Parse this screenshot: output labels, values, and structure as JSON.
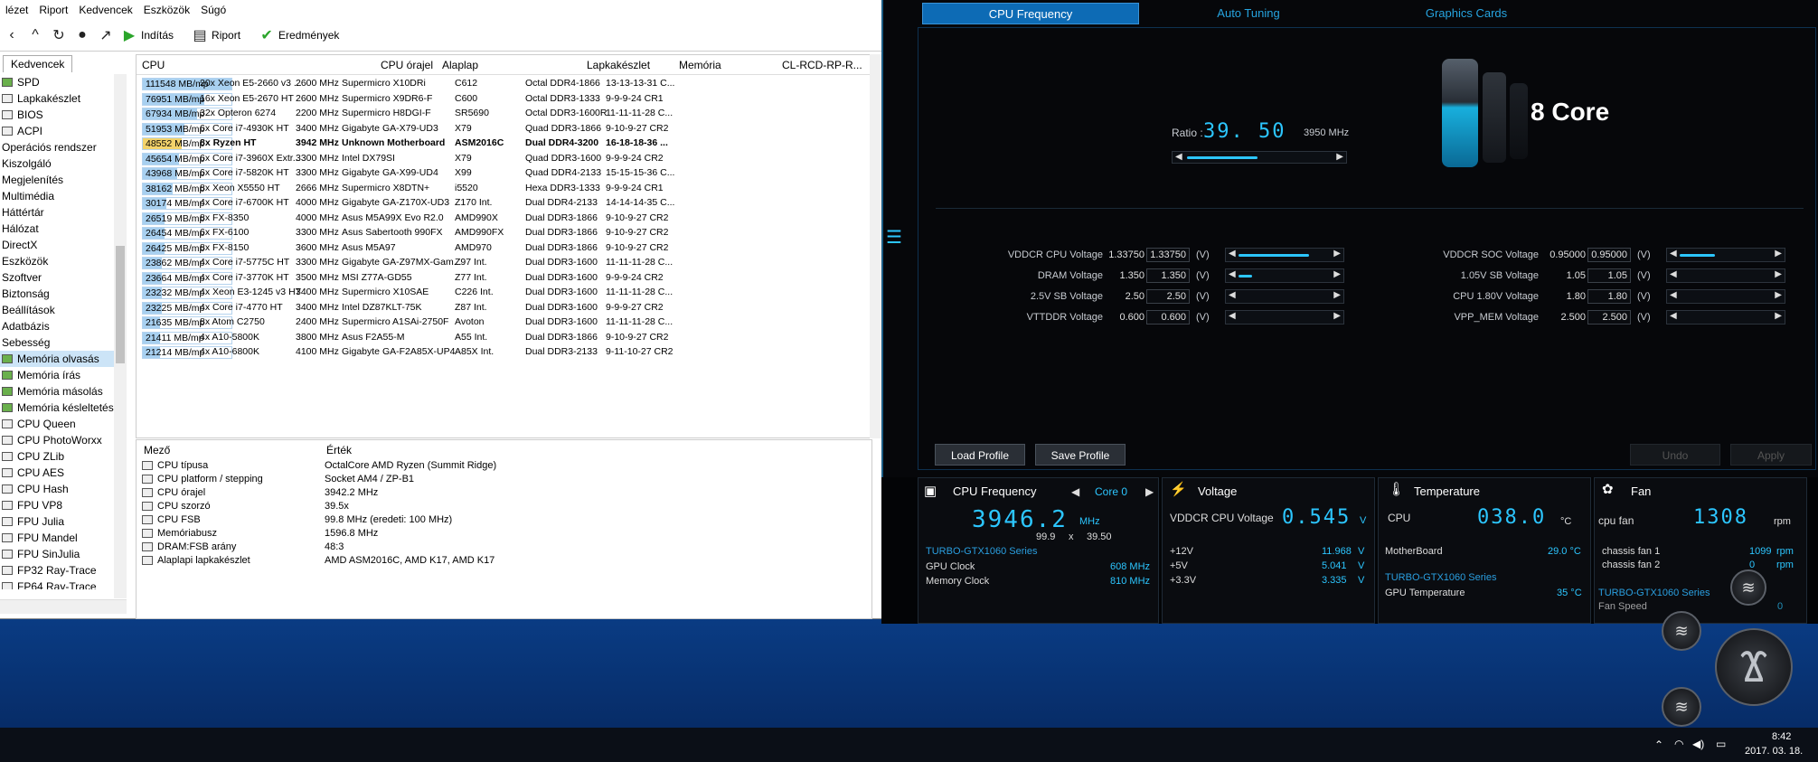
{
  "aida": {
    "menu": [
      "lézet",
      "Riport",
      "Kedvencek",
      "Eszközök",
      "Súgó"
    ],
    "toolbar": {
      "start": "Indítás",
      "report": "Riport",
      "results": "Eredmények"
    },
    "left_tab": "Kedvencek",
    "tree": [
      {
        "label": "SPD",
        "icon": "ram-icon"
      },
      {
        "label": "Lapkakészlet",
        "icon": "chip-icon"
      },
      {
        "label": "BIOS",
        "icon": "chip-icon"
      },
      {
        "label": "ACPI",
        "icon": "chip-icon"
      },
      {
        "label": "Operációs rendszer",
        "icon": ""
      },
      {
        "label": "Kiszolgáló",
        "icon": ""
      },
      {
        "label": "Megjelenítés",
        "icon": ""
      },
      {
        "label": "Multimédia",
        "icon": ""
      },
      {
        "label": "Háttértár",
        "icon": ""
      },
      {
        "label": "Hálózat",
        "icon": ""
      },
      {
        "label": "DirectX",
        "icon": ""
      },
      {
        "label": "Eszközök",
        "icon": ""
      },
      {
        "label": "Szoftver",
        "icon": ""
      },
      {
        "label": "Biztonság",
        "icon": ""
      },
      {
        "label": "Beállítások",
        "icon": ""
      },
      {
        "label": "Adatbázis",
        "icon": ""
      },
      {
        "label": "Sebesség",
        "icon": ""
      },
      {
        "label": "Memória olvasás",
        "icon": "ram-icon",
        "selected": true
      },
      {
        "label": "Memória írás",
        "icon": "ram-icon"
      },
      {
        "label": "Memória másolás",
        "icon": "ram-icon"
      },
      {
        "label": "Memória késleltetés",
        "icon": "ram-icon"
      },
      {
        "label": "CPU Queen",
        "icon": "cpu-icon"
      },
      {
        "label": "CPU PhotoWorxx",
        "icon": "cpu-icon"
      },
      {
        "label": "CPU ZLib",
        "icon": "cpu-icon"
      },
      {
        "label": "CPU AES",
        "icon": "cpu-icon"
      },
      {
        "label": "CPU Hash",
        "icon": "cpu-icon"
      },
      {
        "label": "FPU VP8",
        "icon": "cpu-icon"
      },
      {
        "label": "FPU Julia",
        "icon": "cpu-icon"
      },
      {
        "label": "FPU Mandel",
        "icon": "cpu-icon"
      },
      {
        "label": "FPU SinJulia",
        "icon": "cpu-icon"
      },
      {
        "label": "FP32 Ray-Trace",
        "icon": "cpu-icon"
      },
      {
        "label": "FP64 Ray-Trace",
        "icon": "cpu-icon"
      }
    ],
    "table": {
      "headers": [
        "CPU",
        "CPU órajel",
        "Alaplap",
        "Lapkakészlet",
        "Memória",
        "CL-RCD-RP-R..."
      ],
      "rows": [
        {
          "score": "111548 MB/mp",
          "cpu": "20x Xeon E5-2660 v3 ...",
          "clock": "2600 MHz",
          "board": "Supermicro X10DRi",
          "chipset": "C612",
          "mem": "Octal DDR4-1866",
          "timing": "13-13-13-31 C...",
          "frac": 1.0
        },
        {
          "score": "76951 MB/mp",
          "cpu": "16x Xeon E5-2670 HT",
          "clock": "2600 MHz",
          "board": "Supermicro X9DR6-F",
          "chipset": "C600",
          "mem": "Octal DDR3-1333",
          "timing": "9-9-9-24 CR1",
          "frac": 0.69
        },
        {
          "score": "67934 MB/mp",
          "cpu": "32x Opteron 6274",
          "clock": "2200 MHz",
          "board": "Supermicro H8DGI-F",
          "chipset": "SR5690",
          "mem": "Octal DDR3-1600R",
          "timing": "11-11-11-28 C...",
          "frac": 0.61
        },
        {
          "score": "51953 MB/mp",
          "cpu": "6x Core i7-4930K HT",
          "clock": "3400 MHz",
          "board": "Gigabyte GA-X79-UD3",
          "chipset": "X79",
          "mem": "Quad DDR3-1866",
          "timing": "9-10-9-27 CR2",
          "frac": 0.47
        },
        {
          "score": "48552 MB/mp",
          "cpu": "8x Ryzen HT",
          "clock": "3942 MHz",
          "board": "Unknown Motherboard",
          "chipset": "ASM2016C",
          "mem": "Dual DDR4-3200",
          "timing": "16-18-18-36 ...",
          "frac": 0.44,
          "highlight": true
        },
        {
          "score": "45654 MB/mp",
          "cpu": "6x Core i7-3960X Extr...",
          "clock": "3300 MHz",
          "board": "Intel DX79SI",
          "chipset": "X79",
          "mem": "Quad DDR3-1600",
          "timing": "9-9-9-24 CR2",
          "frac": 0.41
        },
        {
          "score": "43968 MB/mp",
          "cpu": "6x Core i7-5820K HT",
          "clock": "3300 MHz",
          "board": "Gigabyte GA-X99-UD4",
          "chipset": "X99",
          "mem": "Quad DDR4-2133",
          "timing": "15-15-15-36 C...",
          "frac": 0.39
        },
        {
          "score": "38162 MB/mp",
          "cpu": "8x Xeon X5550 HT",
          "clock": "2666 MHz",
          "board": "Supermicro X8DTN+",
          "chipset": "i5520",
          "mem": "Hexa DDR3-1333",
          "timing": "9-9-9-24 CR1",
          "frac": 0.34
        },
        {
          "score": "30174 MB/mp",
          "cpu": "4x Core i7-6700K HT",
          "clock": "4000 MHz",
          "board": "Gigabyte GA-Z170X-UD3",
          "chipset": "Z170 Int.",
          "mem": "Dual DDR4-2133",
          "timing": "14-14-14-35 C...",
          "frac": 0.27
        },
        {
          "score": "26519 MB/mp",
          "cpu": "8x FX-8350",
          "clock": "4000 MHz",
          "board": "Asus M5A99X Evo R2.0",
          "chipset": "AMD990X",
          "mem": "Dual DDR3-1866",
          "timing": "9-10-9-27 CR2",
          "frac": 0.24
        },
        {
          "score": "26454 MB/mp",
          "cpu": "6x FX-6100",
          "clock": "3300 MHz",
          "board": "Asus Sabertooth 990FX",
          "chipset": "AMD990FX",
          "mem": "Dual DDR3-1866",
          "timing": "9-10-9-27 CR2",
          "frac": 0.24
        },
        {
          "score": "26425 MB/mp",
          "cpu": "8x FX-8150",
          "clock": "3600 MHz",
          "board": "Asus M5A97",
          "chipset": "AMD970",
          "mem": "Dual DDR3-1866",
          "timing": "9-10-9-27 CR2",
          "frac": 0.24
        },
        {
          "score": "23862 MB/mp",
          "cpu": "4x Core i7-5775C HT",
          "clock": "3300 MHz",
          "board": "Gigabyte GA-Z97MX-Gam...",
          "chipset": "Z97 Int.",
          "mem": "Dual DDR3-1600",
          "timing": "11-11-11-28 C...",
          "frac": 0.21
        },
        {
          "score": "23664 MB/mp",
          "cpu": "4x Core i7-3770K HT",
          "clock": "3500 MHz",
          "board": "MSI Z77A-GD55",
          "chipset": "Z77 Int.",
          "mem": "Dual DDR3-1600",
          "timing": "9-9-9-24 CR2",
          "frac": 0.21
        },
        {
          "score": "23232 MB/mp",
          "cpu": "4x Xeon E3-1245 v3 HT",
          "clock": "3400 MHz",
          "board": "Supermicro X10SAE",
          "chipset": "C226 Int.",
          "mem": "Dual DDR3-1600",
          "timing": "11-11-11-28 C...",
          "frac": 0.21
        },
        {
          "score": "23225 MB/mp",
          "cpu": "4x Core i7-4770 HT",
          "clock": "3400 MHz",
          "board": "Intel DZ87KLT-75K",
          "chipset": "Z87 Int.",
          "mem": "Dual DDR3-1600",
          "timing": "9-9-9-27 CR2",
          "frac": 0.21
        },
        {
          "score": "21635 MB/mp",
          "cpu": "8x Atom C2750",
          "clock": "2400 MHz",
          "board": "Supermicro A1SAi-2750F",
          "chipset": "Avoton",
          "mem": "Dual DDR3-1600",
          "timing": "11-11-11-28 C...",
          "frac": 0.19
        },
        {
          "score": "21411 MB/mp",
          "cpu": "4x A10-5800K",
          "clock": "3800 MHz",
          "board": "Asus F2A55-M",
          "chipset": "A55 Int.",
          "mem": "Dual DDR3-1866",
          "timing": "9-10-9-27 CR2",
          "frac": 0.19
        },
        {
          "score": "21214 MB/mp",
          "cpu": "4x A10-6800K",
          "clock": "4100 MHz",
          "board": "Gigabyte GA-F2A85X-UP4",
          "chipset": "A85X Int.",
          "mem": "Dual DDR3-2133",
          "timing": "9-11-10-27 CR2",
          "frac": 0.19
        }
      ]
    },
    "detail": {
      "headers": [
        "Mező",
        "Érték"
      ],
      "rows": [
        {
          "k": "CPU típusa",
          "v": "OctalCore AMD Ryzen  (Summit Ridge)"
        },
        {
          "k": "CPU platform / stepping",
          "v": "Socket AM4 / ZP-B1"
        },
        {
          "k": "CPU órajel",
          "v": "3942.2 MHz"
        },
        {
          "k": "CPU szorzó",
          "v": "39.5x"
        },
        {
          "k": "CPU FSB",
          "v": "99.8 MHz  (eredeti: 100 MHz)"
        },
        {
          "k": "Memóriabusz",
          "v": "1596.8 MHz"
        },
        {
          "k": "DRAM:FSB arány",
          "v": "48:3"
        },
        {
          "k": "Alaplapi lapkakészlet",
          "v": "AMD ASM2016C, AMD K17, AMD K17"
        }
      ]
    }
  },
  "asus": {
    "tabs": [
      "CPU Frequency",
      "Auto Tuning",
      "Graphics Cards"
    ],
    "ratio_label": "Ratio :",
    "ratio_value": "39. 50",
    "ratio_mhz": "3950 MHz",
    "core_label": "8 Core",
    "unit": "(V)",
    "voltages_left": [
      {
        "label": "VDDCR CPU Voltage",
        "val": "1.33750",
        "box": "1.33750",
        "fill": 0.8
      },
      {
        "label": "DRAM Voltage",
        "val": "1.350",
        "box": "1.350",
        "fill": 0.15
      },
      {
        "label": "2.5V SB Voltage",
        "val": "2.50",
        "box": "2.50",
        "fill": 0.0
      },
      {
        "label": "VTTDDR Voltage",
        "val": "0.600",
        "box": "0.600",
        "fill": 0.0
      }
    ],
    "voltages_right": [
      {
        "label": "VDDCR SOC Voltage",
        "val": "0.95000",
        "box": "0.95000",
        "fill": 0.4
      },
      {
        "label": "1.05V SB Voltage",
        "val": "1.05",
        "box": "1.05",
        "fill": 0.0
      },
      {
        "label": "CPU 1.80V Voltage",
        "val": "1.80",
        "box": "1.80",
        "fill": 0.0
      },
      {
        "label": "VPP_MEM Voltage",
        "val": "2.500",
        "box": "2.500",
        "fill": 0.0
      }
    ],
    "buttons": {
      "load": "Load Profile",
      "save": "Save Profile",
      "undo": "Undo",
      "apply": "Apply"
    }
  },
  "panels": {
    "freq": {
      "title": "CPU Frequency",
      "core": "Core 0",
      "value": "3946.2",
      "unit": "MHz",
      "fsb": "99.9",
      "x": "x",
      "mult": "39.50",
      "gpu_series": "TURBO-GTX1060 Series",
      "gpu_clock_label": "GPU Clock",
      "gpu_clock": "608 MHz",
      "mem_clock_label": "Memory Clock",
      "mem_clock": "810 MHz"
    },
    "voltage": {
      "title": "Voltage",
      "main_label": "VDDCR CPU Voltage",
      "main_value": "0.545",
      "main_unit": "V",
      "rails": [
        {
          "label": "+12V",
          "value": "11.968",
          "unit": "V"
        },
        {
          "label": "+5V",
          "value": "5.041",
          "unit": "V"
        },
        {
          "label": "+3.3V",
          "value": "3.335",
          "unit": "V"
        }
      ]
    },
    "temp": {
      "title": "Temperature",
      "cpu_label": "CPU",
      "cpu_value": "038.0",
      "cpu_unit": "°C",
      "mb_label": "MotherBoard",
      "mb_value": "29.0 °C",
      "gpu_series": "TURBO-GTX1060 Series",
      "gpu_label": "GPU Temperature",
      "gpu_value": "35 °C"
    },
    "fan": {
      "title": "Fan",
      "cpu_fan_label": "cpu fan",
      "cpu_fan_value": "1308",
      "cpu_fan_unit": "rpm",
      "rows": [
        {
          "label": "chassis fan 1",
          "value": "1099",
          "unit": "rpm"
        },
        {
          "label": "chassis fan 2",
          "value": "0",
          "unit": "rpm"
        }
      ],
      "gpu_series": "TURBO-GTX1060 Series",
      "fan_speed_label": "Fan Speed",
      "fan_speed_value": "0"
    }
  },
  "tray": {
    "time": "8:42",
    "date": "2017. 03. 18."
  },
  "colors": {
    "accent": "#2cc6ff",
    "tab_active": "#0d6bb5",
    "desktop": "#0c4ea0"
  }
}
